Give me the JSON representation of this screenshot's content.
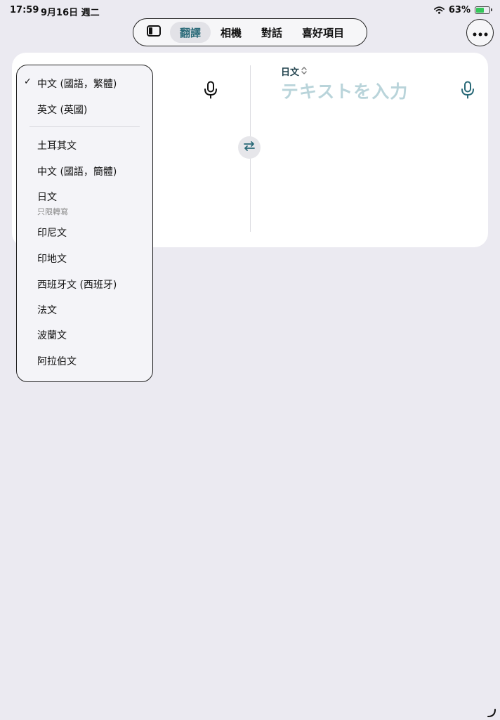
{
  "status_bar": {
    "time": "17:59",
    "date": "9月16日 週二",
    "battery": "63%",
    "battery_level": 0.63
  },
  "tab_bar": {
    "tabs": [
      {
        "label": "翻譯",
        "active": true
      },
      {
        "label": "相機",
        "active": false
      },
      {
        "label": "對話",
        "active": false
      },
      {
        "label": "喜好項目",
        "active": false
      }
    ]
  },
  "target": {
    "language": "日文",
    "placeholder": "テキストを入力"
  },
  "language_menu": {
    "items": [
      {
        "label": "中文 (國語，繁體)",
        "checked": true,
        "sub": ""
      },
      {
        "label": "英文 (英國)",
        "checked": false,
        "sub": ""
      },
      {
        "label": "土耳其文",
        "checked": false,
        "sub": ""
      },
      {
        "label": "中文 (國語，簡體)",
        "checked": false,
        "sub": ""
      },
      {
        "label": "日文",
        "checked": false,
        "sub": "只限轉寫"
      },
      {
        "label": "印尼文",
        "checked": false,
        "sub": ""
      },
      {
        "label": "印地文",
        "checked": false,
        "sub": ""
      },
      {
        "label": "西班牙文 (西班牙)",
        "checked": false,
        "sub": ""
      },
      {
        "label": "法文",
        "checked": false,
        "sub": ""
      },
      {
        "label": "波蘭文",
        "checked": false,
        "sub": ""
      },
      {
        "label": "阿拉伯文",
        "checked": false,
        "sub": ""
      }
    ],
    "check_mark": "✓"
  },
  "colors": {
    "accent": "#2a6a78",
    "background": "#ebeaf1",
    "placeholder": "#b9d4da"
  }
}
